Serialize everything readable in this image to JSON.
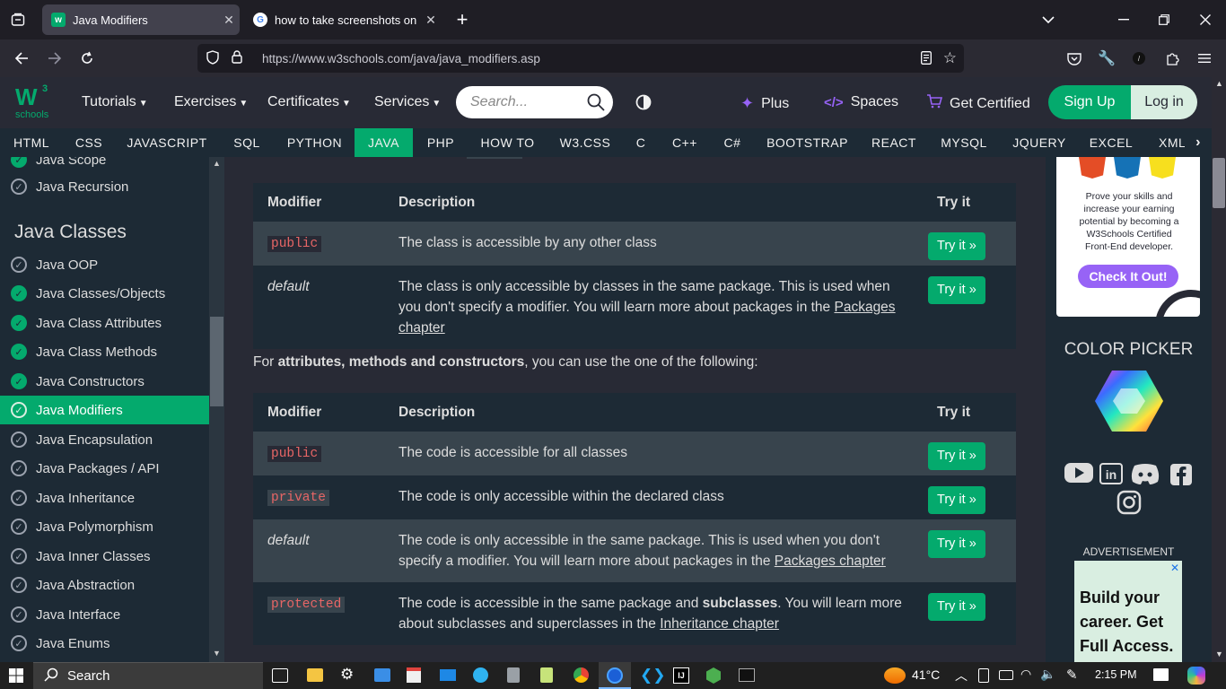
{
  "browser": {
    "tabs": [
      {
        "title": "Java Modifiers",
        "favicon": "w3schools-favicon"
      },
      {
        "title": "how to take screenshots on lapt",
        "favicon": "google-favicon"
      }
    ],
    "url": "https://www.w3schools.com/java/java_modifiers.asp"
  },
  "header": {
    "logo_top": "W",
    "logo_sup": "3",
    "logo_bottom": "schools",
    "menu": [
      "Tutorials",
      "Exercises",
      "Certificates",
      "Services"
    ],
    "search_placeholder": "Search...",
    "plus": "Plus",
    "spaces": "Spaces",
    "get_certified": "Get Certified",
    "signup": "Sign Up",
    "login": "Log in"
  },
  "topics": [
    "HTML",
    "CSS",
    "JAVASCRIPT",
    "SQL",
    "PYTHON",
    "JAVA",
    "PHP",
    "HOW TO",
    "W3.CSS",
    "C",
    "C++",
    "C#",
    "BOOTSTRAP",
    "REACT",
    "MYSQL",
    "JQUERY",
    "EXCEL",
    "XML"
  ],
  "topics_active": "JAVA",
  "sidebar": {
    "top_items": [
      {
        "label": "Java Scope",
        "done": true
      },
      {
        "label": "Java Recursion",
        "done": true
      }
    ],
    "section_title": "Java Classes",
    "items": [
      {
        "label": "Java OOP",
        "done": false
      },
      {
        "label": "Java Classes/Objects",
        "done": true
      },
      {
        "label": "Java Class Attributes",
        "done": true
      },
      {
        "label": "Java Class Methods",
        "done": true
      },
      {
        "label": "Java Constructors",
        "done": true
      },
      {
        "label": "Java Modifiers",
        "done": true,
        "active": true
      },
      {
        "label": "Java Encapsulation",
        "done": false
      },
      {
        "label": "Java Packages / API",
        "done": false
      },
      {
        "label": "Java Inheritance",
        "done": false
      },
      {
        "label": "Java Polymorphism",
        "done": false
      },
      {
        "label": "Java Inner Classes",
        "done": false
      },
      {
        "label": "Java Abstraction",
        "done": false
      },
      {
        "label": "Java Interface",
        "done": false
      },
      {
        "label": "Java Enums",
        "done": false
      }
    ]
  },
  "content": {
    "table_headers": {
      "modifier": "Modifier",
      "description": "Description",
      "tryit": "Try it"
    },
    "tryit_label": "Try it »",
    "table1": [
      {
        "modifier": "public",
        "code": true,
        "desc": "The class is accessible by any other class"
      },
      {
        "modifier": "default",
        "code": false,
        "desc": "The class is only accessible by classes in the same package. This is used when you don't specify a modifier. You will learn more about packages in the ",
        "link": "Packages chapter"
      }
    ],
    "between_prefix": "For ",
    "between_bold": "attributes, methods and constructors",
    "between_suffix": ", you can use the one of the following:",
    "table2": [
      {
        "modifier": "public",
        "code": true,
        "desc": "The code is accessible for all classes"
      },
      {
        "modifier": "private",
        "code": true,
        "desc": "The code is only accessible within the declared class"
      },
      {
        "modifier": "default",
        "code": false,
        "desc": "The code is only accessible in the same package. This is used when you don't specify a modifier. You will learn more about packages in the ",
        "link": "Packages chapter"
      },
      {
        "modifier": "protected",
        "code": true,
        "desc_pre": "The code is accessible in the same package and ",
        "desc_bold": "subclasses",
        "desc": ". You will learn more about subclasses and superclasses in the ",
        "link": "Inheritance chapter"
      }
    ]
  },
  "right": {
    "ad_text": "Prove your skills and increase your earning potential by becoming a W3Schools Certified Front-End developer.",
    "ad_button": "Check It Out!",
    "color_picker": "COLOR PICKER",
    "advertisement": "ADVERTISEMENT",
    "ad2": "Build your career. Get Full Access."
  },
  "taskbar": {
    "search": "Search",
    "temp": "41°C",
    "time": "2:15 PM"
  }
}
